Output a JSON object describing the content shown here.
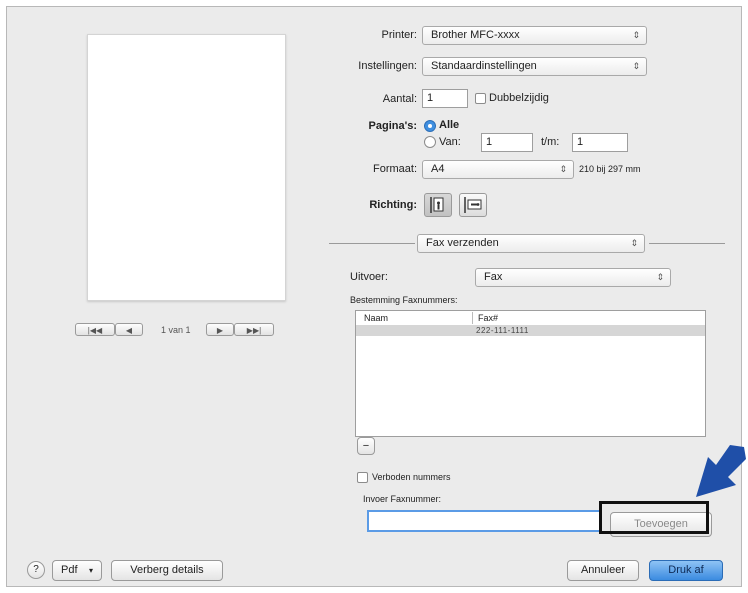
{
  "preview": {
    "page_indicator": "1 van 1",
    "first_label": "|◀◀",
    "prev_label": "◀",
    "next_label": "▶",
    "last_label": "▶▶|"
  },
  "settings": {
    "printer_label": "Printer:",
    "printer_value": "Brother MFC-xxxx",
    "presets_label": "Instellingen:",
    "presets_value": "Standaardinstellingen",
    "copies_label": "Aantal:",
    "copies_value": "1",
    "duplex_label": "Dubbelzijdig",
    "pages_label": "Pagina's:",
    "pages_all_label": "Alle",
    "pages_from_label": "Van:",
    "pages_from_value": "1",
    "pages_to_label": "t/m:",
    "pages_to_value": "1",
    "paper_size_label": "Formaat:",
    "paper_size_value": "A4",
    "paper_dimensions": "210 bij 297 mm",
    "orientation_label": "Richting:"
  },
  "panel_select": {
    "value": "Fax verzenden"
  },
  "fax": {
    "output_label": "Uitvoer:",
    "output_value": "Fax",
    "destination_label": "Bestemming Faxnummers:",
    "table_headers": [
      "Naam",
      "Fax#"
    ],
    "rows": [
      {
        "name": "",
        "fax": "222-111-1111"
      }
    ],
    "remove_label": "−",
    "dial_restriction_label": "Verboden nummers",
    "input_label": "Invoer Faxnummer:",
    "input_value": "",
    "add_button": "Toevoegen"
  },
  "footer": {
    "help_label": "?",
    "pdf_label": "Pdf",
    "hide_details_label": "Verberg details",
    "cancel_label": "Annuleer",
    "print_label": "Druk af"
  },
  "colors": {
    "dialog_bg": "#ebebeb",
    "default_button": "#3b8be0",
    "annotation_arrow": "#1f4fa8",
    "radio_selected": "#3f8fe0"
  }
}
